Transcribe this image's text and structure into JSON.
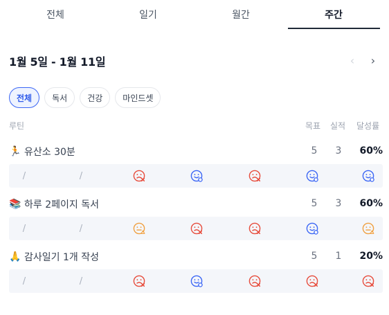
{
  "tabs": [
    {
      "label": "전체",
      "active": false
    },
    {
      "label": "일기",
      "active": false
    },
    {
      "label": "월간",
      "active": false
    },
    {
      "label": "주간",
      "active": true
    }
  ],
  "range_label": "1월 5일 - 1월 11일",
  "nav": {
    "prev": "‹",
    "next": "›"
  },
  "filters": [
    {
      "label": "전체",
      "active": true
    },
    {
      "label": "독서",
      "active": false
    },
    {
      "label": "건강",
      "active": false
    },
    {
      "label": "마인드셋",
      "active": false
    }
  ],
  "table_header": {
    "label": "루틴",
    "goal": "목표",
    "done": "실적",
    "rate": "달성률"
  },
  "colors": {
    "fail": "#e74c3c",
    "success": "#3b66f5",
    "partial": "#f0a040",
    "accent": "#2f5bea"
  },
  "routines": [
    {
      "emoji": "🏃",
      "emoji_name": "running-person-icon",
      "name": "유산소 30분",
      "goal": "5",
      "done": "3",
      "rate": "60%",
      "days": [
        "empty",
        "empty",
        "fail",
        "success",
        "fail",
        "success",
        "success"
      ]
    },
    {
      "emoji": "📚",
      "emoji_name": "books-icon",
      "name": "하루 2페이지 독서",
      "goal": "5",
      "done": "3",
      "rate": "60%",
      "days": [
        "empty",
        "empty",
        "partial",
        "fail",
        "fail",
        "success",
        "partial"
      ]
    },
    {
      "emoji": "🙏",
      "emoji_name": "praying-hands-icon",
      "name": "감사일기 1개 작성",
      "goal": "5",
      "done": "1",
      "rate": "20%",
      "days": [
        "empty",
        "empty",
        "fail",
        "success",
        "fail",
        "fail",
        "fail"
      ]
    }
  ],
  "empty_day_symbol": "/"
}
